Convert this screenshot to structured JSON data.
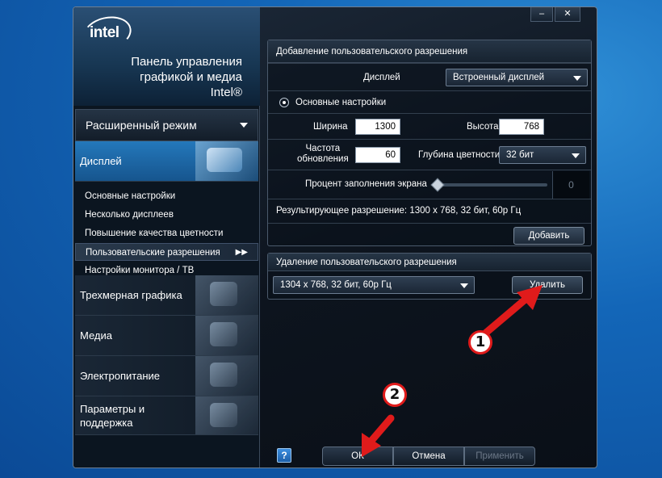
{
  "branding": {
    "logo_text": "intel",
    "panel_title_lines": [
      "Панель управления",
      "графикой и медиа",
      "Intel®"
    ]
  },
  "window_controls": {
    "minimize": "–",
    "close": "✕"
  },
  "sidebar": {
    "mode_selector": "Расширенный режим",
    "display_category": "Дисплей",
    "display_subitems": [
      "Основные настройки",
      "Несколько дисплеев",
      "Повышение качества цветности",
      "Пользовательские разрешения",
      "Настройки монитора / ТВ"
    ],
    "active_subitem_marker": "▶▶",
    "other_categories": [
      {
        "label": "Трехмерная графика",
        "icon": "3d-shapes-icon"
      },
      {
        "label": "Медиа",
        "icon": "media-camera-icon"
      },
      {
        "label": "Электропитание",
        "icon": "power-plug-icon"
      },
      {
        "label": "Параметры и",
        "label2": "поддержка",
        "icon": "support-tools-icon"
      }
    ]
  },
  "add_section": {
    "title": "Добавление пользовательского разрешения",
    "display_label": "Дисплей",
    "display_value": "Встроенный дисплей",
    "basic_settings_label": "Основные настройки",
    "width_label": "Ширина",
    "width_value": "1300",
    "height_label": "Высота",
    "height_value": "768",
    "refresh_label_line1": "Частота",
    "refresh_label_line2": "обновления",
    "refresh_value": "60",
    "color_depth_label": "Глубина цветности",
    "color_depth_value": "32 бит",
    "fill_label": "Процент заполнения экрана",
    "fill_value": "0",
    "fill_fraction": 0,
    "result_text": "Результирующее разрешение: 1300 x 768, 32 бит, 60р Гц",
    "add_button": "Добавить"
  },
  "remove_section": {
    "title": "Удаление пользовательского разрешения",
    "resolution_value": "1304 x 768, 32 бит, 60р Гц",
    "delete_button": "Удалить"
  },
  "footer": {
    "help": "?",
    "ok": "ОК",
    "cancel": "Отмена",
    "apply": "Применить"
  },
  "annotations": {
    "badge1": "1",
    "badge2": "2",
    "arrow_color": "#e01b1b"
  }
}
